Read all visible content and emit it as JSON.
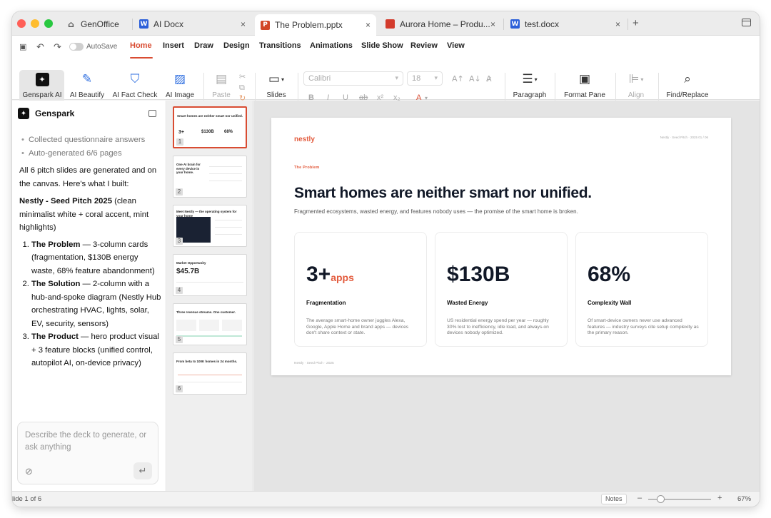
{
  "tabs": [
    {
      "label": "GenOffice",
      "icon": "home-icon"
    },
    {
      "label": "AI Docx",
      "icon": "word-icon",
      "badge": "W"
    },
    {
      "label": "The Problem.pptx",
      "icon": "powerpoint-icon",
      "badge": "P"
    },
    {
      "label": "Aurora Home – Produ...",
      "icon": "pdf-icon"
    },
    {
      "label": "test.docx",
      "icon": "word-icon",
      "badge": "W"
    }
  ],
  "toolbar": {
    "autosave": "AutoSave",
    "menu": [
      "Home",
      "Insert",
      "Draw",
      "Design",
      "Transitions",
      "Animations",
      "Slide Show",
      "Review",
      "View"
    ],
    "tools": {
      "genspark_ai": "Genspark AI",
      "ai_beautify": "AI Beautify",
      "ai_fact_check": "AI Fact Check",
      "ai_image": "AI Image",
      "paste": "Paste",
      "slides": "Slides",
      "paragraph": "Paragraph",
      "format_pane": "Format Pane",
      "align": "Align",
      "find_replace": "Find/Replace"
    },
    "font_name": "Calibri",
    "font_size": "18"
  },
  "panel": {
    "title": "Genspark",
    "bullets": [
      "Collected questionnaire answers",
      "Auto-generated 6/6 pages"
    ],
    "intro": "All 6 pitch slides are generated and on the canvas. Here's what I built:",
    "deck_name": "Nestly - Seed Pitch 2025",
    "deck_style": "(clean minimalist white + coral accent, mint highlights)",
    "items": [
      {
        "title": "The Problem",
        "text": "— 3-column cards (fragmentation, $130B energy waste, 68% feature abandonment)"
      },
      {
        "title": "The Solution",
        "text": "— 2-column with a hub-and-spoke diagram (Nestly Hub orchestrating  HVAC, lights, solar, EV, security, sensors)"
      },
      {
        "title": "The Product",
        "text": "— hero product visual + 3 feature blocks (unified control, autopilot AI, on-device privacy)"
      }
    ],
    "input_placeholder": "Describe the deck to generate, or ask anything"
  },
  "thumbnails": [
    {
      "num": "1",
      "title": "Smart homes are neither smart nor unified."
    },
    {
      "num": "2",
      "title": "One AI brain for every device in your home."
    },
    {
      "num": "3",
      "title": "Meet Nestly — the operating system for your home"
    },
    {
      "num": "4",
      "title": "Market Opportunity",
      "stat": "$45.7B"
    },
    {
      "num": "5",
      "title": "Three revenue streams. One customer."
    },
    {
      "num": "6",
      "title": "From beta to 100K homes in 24 months."
    }
  ],
  "slide": {
    "logo": "nestly",
    "top_right": "Nestly · Seed Pitch · 2025   01 / 06",
    "kicker": "The Problem",
    "title": "Smart homes are neither smart nor unified.",
    "subtitle": "Fragmented ecosystems, wasted energy, and features nobody uses — the promise of the smart home is broken.",
    "cards": [
      {
        "value": "3+",
        "unit": "apps",
        "label": "Fragmentation",
        "desc": "The average smart-home owner juggles Alexa, Google, Apple Home and brand apps — devices don't share context or state."
      },
      {
        "value": "$130B",
        "unit": "",
        "label": "Wasted Energy",
        "desc": "US residential energy spend per year — roughly 30% lost to inefficiency, idle load, and always-on devices nobody optimized."
      },
      {
        "value": "68%",
        "unit": "",
        "label": "Complexity Wall",
        "desc": "Of smart-device owners never use advanced features — industry surveys cite setup complexity as the primary reason."
      }
    ],
    "footer": "Nestly · Seed Pitch · 2025"
  },
  "status": {
    "slide_info": "lide 1 of 6",
    "notes": "Notes",
    "zoom_minus": "–",
    "zoom_plus": "+",
    "zoom": "67%"
  },
  "colors": {
    "accent": "#d94c32",
    "coral": "#e35b3d",
    "ai_blue": "#2f6fe0"
  }
}
